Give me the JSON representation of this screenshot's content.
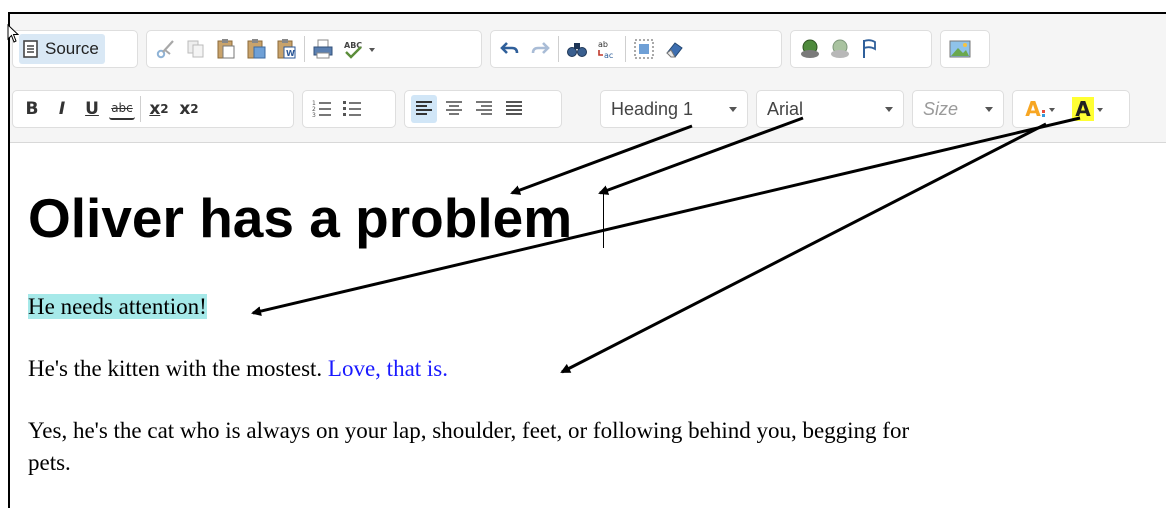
{
  "toolbar": {
    "source_label": "Source",
    "bold_label": "B",
    "italic_label": "I",
    "underline_label": "U",
    "strike_label": "abc",
    "subscript_label": "x",
    "subscript_sub": "2",
    "superscript_label": "x",
    "superscript_sup": "2",
    "format_value": "Heading 1",
    "font_value": "Arial",
    "size_placeholder": "Size",
    "text_color_label": "A",
    "bg_color_label": "A",
    "spell_label": "ABC",
    "colors": {
      "active_button_bg": "#d1e6f7",
      "text_color_accent": "#f7a623",
      "bg_color_highlight": "#ffff33"
    }
  },
  "document": {
    "heading": "Oliver has a problem",
    "paragraphs": [
      {
        "highlighted": "He needs attention!"
      },
      {
        "normal": "He's the kitten with the mostest. ",
        "blue": "Love, that is."
      },
      {
        "line1": "Yes, he's the cat who is always on your lap, shoulder, feet, or following behind you, begging for",
        "line2": "pets."
      }
    ],
    "colors": {
      "highlight": "#a6e9e9",
      "blue_text": "#1a1aff"
    }
  },
  "icons": {
    "clipboard": [
      "cut-icon",
      "copy-icon",
      "paste-icon",
      "paste-text-icon",
      "paste-word-icon"
    ],
    "edit": [
      "print-icon",
      "spellcheck-icon",
      "undo-icon",
      "redo-icon",
      "find-icon",
      "replace-icon",
      "select-all-icon",
      "remove-format-icon"
    ],
    "links": [
      "link-icon",
      "unlink-icon",
      "anchor-icon",
      "image-icon"
    ],
    "lists": [
      "numbered-list-icon",
      "bulleted-list-icon"
    ],
    "align": [
      "align-left-icon",
      "align-center-icon",
      "align-right-icon",
      "justify-icon"
    ]
  }
}
